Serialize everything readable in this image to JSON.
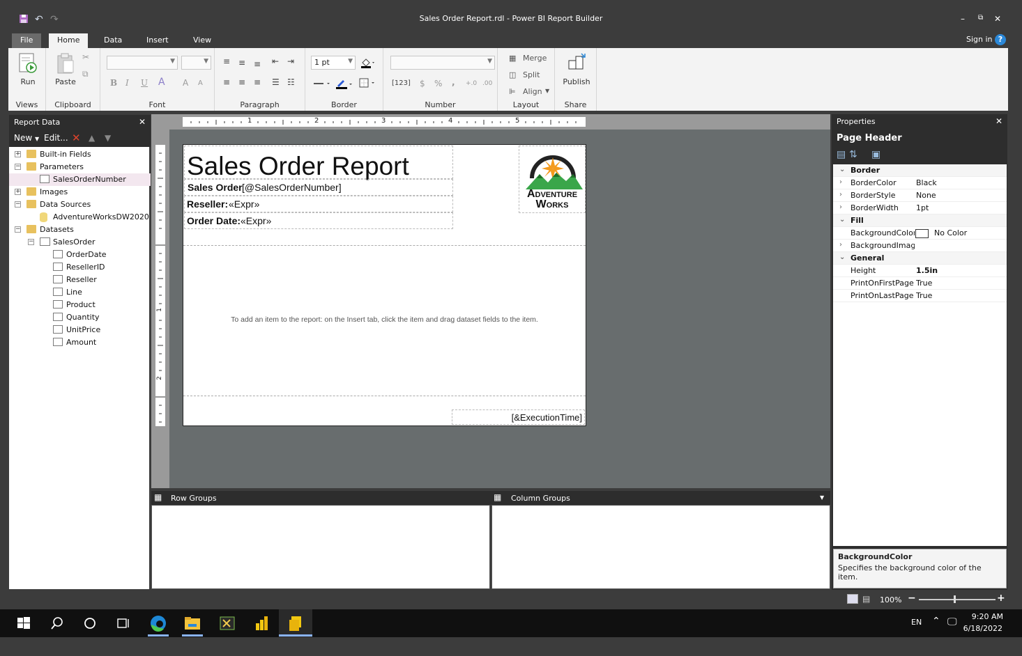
{
  "window": {
    "title": "Sales Order Report.rdl - Power BI Report Builder",
    "minimize": "–",
    "restore": "⧉",
    "close": "✕"
  },
  "tabs": [
    {
      "label": "File"
    },
    {
      "label": "Home"
    },
    {
      "label": "Data"
    },
    {
      "label": "Insert"
    },
    {
      "label": "View"
    }
  ],
  "signin": "Sign in",
  "help": "?",
  "ribbon": {
    "views": {
      "label": "Views",
      "run": "Run"
    },
    "clipboard": {
      "label": "Clipboard",
      "paste": "Paste"
    },
    "font": {
      "label": "Font",
      "bold": "B",
      "italic": "I",
      "underline": "U",
      "font_color": "A",
      "grow": "A",
      "shrink": "A"
    },
    "paragraph": {
      "label": "Paragraph"
    },
    "border": {
      "label": "Border",
      "width": "1 pt"
    },
    "number": {
      "label": "Number",
      "placeholder": "[123]",
      "currency": "$",
      "percent": "%",
      "comma": ",",
      "inc": "+.0",
      "dec": ".00"
    },
    "layout": {
      "label": "Layout",
      "merge": "Merge",
      "split": "Split",
      "align": "Align"
    },
    "share": {
      "label": "Share",
      "publish": "Publish"
    }
  },
  "report_data": {
    "title": "Report Data",
    "close": "✕",
    "toolbar": {
      "new": "New",
      "edit": "Edit..."
    },
    "tree": [
      {
        "label": "Built-in Fields",
        "expander": "+",
        "type": "folder"
      },
      {
        "label": "Parameters",
        "expander": "−",
        "type": "folder"
      },
      {
        "label": "SalesOrderNumber",
        "type": "param"
      },
      {
        "label": "Images",
        "expander": "+",
        "type": "folder"
      },
      {
        "label": "Data Sources",
        "expander": "−",
        "type": "folder"
      },
      {
        "label": "AdventureWorksDW2020",
        "type": "datasource"
      },
      {
        "label": "Datasets",
        "expander": "−",
        "type": "folder"
      },
      {
        "label": "SalesOrder",
        "expander": "−",
        "type": "dataset"
      },
      {
        "label": "OrderDate",
        "type": "field"
      },
      {
        "label": "ResellerID",
        "type": "field"
      },
      {
        "label": "Reseller",
        "type": "field"
      },
      {
        "label": "Line",
        "type": "field"
      },
      {
        "label": "Product",
        "type": "field"
      },
      {
        "label": "Quantity",
        "type": "field"
      },
      {
        "label": "UnitPrice",
        "type": "field"
      },
      {
        "label": "Amount",
        "type": "field"
      }
    ]
  },
  "ruler": {
    "marks": [
      "1",
      "2",
      "3",
      "4",
      "5"
    ],
    "left_marks": [
      "1",
      "2"
    ]
  },
  "report": {
    "title": "Sales Order Report",
    "sales_order_label": "Sales Order",
    "sales_order_value": "[@SalesOrderNumber]",
    "reseller_label": "Reseller:",
    "reseller_value": "«Expr»",
    "order_date_label": "Order Date:",
    "order_date_value": "«Expr»",
    "logo_line1": "Adventure",
    "logo_line2": "Works",
    "body_hint": "To add an item to the report: on the Insert tab, click the item and drag dataset fields to the item.",
    "footer_value": "[&ExecutionTime]"
  },
  "groups": {
    "row": "Row Groups",
    "column": "Column Groups"
  },
  "properties": {
    "title": "Properties",
    "close": "✕",
    "object": "Page Header",
    "rows": [
      {
        "name": "Border",
        "category": true,
        "exp": "⌄"
      },
      {
        "name": "BorderColor",
        "value": "Black",
        "exp": "›"
      },
      {
        "name": "BorderStyle",
        "value": "None",
        "exp": "›"
      },
      {
        "name": "BorderWidth",
        "value": "1pt",
        "exp": "›"
      },
      {
        "name": "Fill",
        "category": true,
        "exp": "⌄"
      },
      {
        "name": "BackgroundColor",
        "value": "No Color",
        "swatch": true
      },
      {
        "name": "BackgroundImage",
        "value": "",
        "exp": "›"
      },
      {
        "name": "General",
        "category": true,
        "exp": "⌄"
      },
      {
        "name": "Height",
        "value": "1.5in",
        "bold": true
      },
      {
        "name": "PrintOnFirstPage",
        "value": "True"
      },
      {
        "name": "PrintOnLastPage",
        "value": "True"
      }
    ],
    "desc_title": "BackgroundColor",
    "desc_text": "Specifies the background color of the item."
  },
  "status": {
    "zoom": "100%"
  },
  "taskbar": {
    "lang": "EN",
    "time": "9:20 AM",
    "date": "6/18/2022"
  }
}
